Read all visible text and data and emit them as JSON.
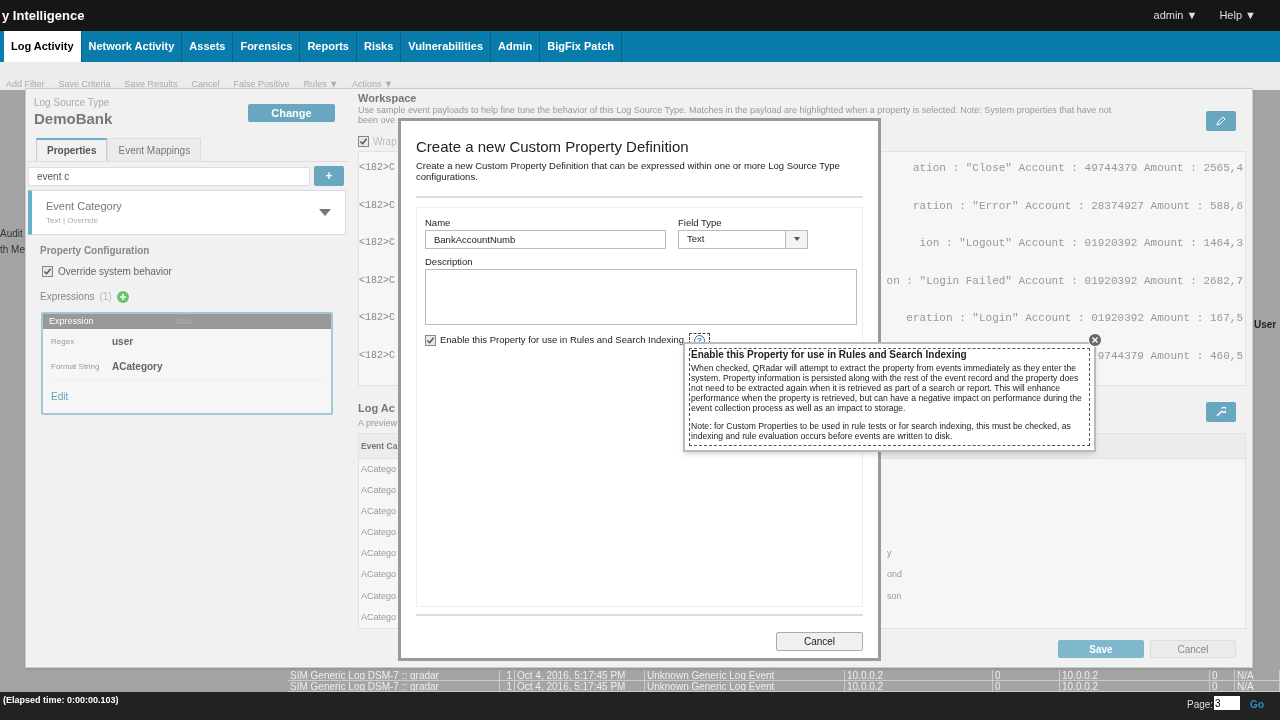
{
  "app_bar": {
    "title": "y Intelligence",
    "menus": [
      "admin ▼",
      "Help ▼"
    ]
  },
  "nav_tabs": [
    {
      "label": "Log Activity",
      "selected": true
    },
    {
      "label": "Network Activity",
      "selected": false
    },
    {
      "label": "Assets",
      "selected": false
    },
    {
      "label": "Forensics",
      "selected": false
    },
    {
      "label": "Reports",
      "selected": false
    },
    {
      "label": "Risks",
      "selected": false
    },
    {
      "label": "Vulnerabilities",
      "selected": false
    },
    {
      "label": "Admin",
      "selected": false
    },
    {
      "label": "BigFix Patch",
      "selected": false
    }
  ],
  "toolbar": [
    "Add Filter",
    "Save Criteria",
    "Save Results",
    "Cancel",
    "False Positive",
    "Rules ▼",
    "Actions ▼"
  ],
  "background_fragments": {
    "left": [
      "Audit",
      "th Me"
    ],
    "right": "User"
  },
  "editor": {
    "log_source_type_label": "Log Source Type",
    "log_source_type": "DemoBank",
    "change_button": "Change",
    "tabs": [
      {
        "label": "Properties",
        "selected": true
      },
      {
        "label": "Event Mappings",
        "selected": false
      }
    ],
    "search": {
      "value": "event c"
    },
    "add_button": "+",
    "property": {
      "name": "Event Category",
      "meta": "Text | Override"
    },
    "configuration": {
      "title": "Property Configuration",
      "override": {
        "label": "Override system behavior",
        "checked": true
      }
    },
    "expressions": {
      "label": "Expressions",
      "count": "(1)",
      "items": [
        {
          "title": "Expression",
          "fields": [
            {
              "label": "Regex",
              "value": "user"
            },
            {
              "label": "Format String",
              "value": "ACategory"
            }
          ],
          "edit": "Edit"
        }
      ]
    },
    "workspace": {
      "title": "Workspace",
      "description_lines": [
        "Use sample event payloads to help fine tune the behavior of this Log Source Type. Matches in the payload are highlighted when a property is selected. Note: System properties that have not",
        "been ove"
      ],
      "wrap": {
        "label": "Wrap",
        "checked": true
      },
      "payloads": [
        {
          "start": "<182>C",
          "end": "ation : \"Close\" Account : 49744379 Amount : 2565,4"
        },
        {
          "start": "<182>C",
          "end": "ration : \"Error\" Account : 28374927 Amount : 588,6"
        },
        {
          "start": "<182>C",
          "end": "ion : \"Logout\" Account : 01920392 Amount : 1464,3"
        },
        {
          "start": "<182>C",
          "end": "on : \"Login Failed\" Account : 01920392 Amount : 2682,7"
        },
        {
          "start": "<182>C",
          "end": "eration : \"Login\" Account : 01920392 Amount : 167,5"
        },
        {
          "start": "<182>C",
          "end": "9744379 Amount : 460,5"
        }
      ]
    },
    "preview": {
      "title": "Log Ac",
      "subtitle": "A preview",
      "column": "Event Ca",
      "rows": [
        {
          "cell": "ACatego"
        },
        {
          "cell": "ACatego"
        },
        {
          "cell": "ACatego"
        },
        {
          "cell": "ACatego"
        },
        {
          "cell": "ACatego",
          "end": "y"
        },
        {
          "cell": "ACatego",
          "end": "ond"
        },
        {
          "cell": "ACatego",
          "end": "son"
        },
        {
          "cell": "ACatego"
        }
      ]
    },
    "save_button": "Save",
    "cancel_button": "Cancel"
  },
  "dialog": {
    "title": "Create a new Custom Property Definition",
    "description": "Create a new Custom Property Definition that can be expressed within one or more Log Source Type configurations.",
    "name": {
      "label": "Name",
      "value": "BankAccountNumb"
    },
    "field_type": {
      "label": "Field Type",
      "value": "Text"
    },
    "description_field": {
      "label": "Description"
    },
    "enable": {
      "label": "Enable this Property for use in Rules and Search Indexing",
      "checked": true
    },
    "help": "?",
    "cancel": "Cancel"
  },
  "tooltip": {
    "title": "Enable this Property for use in Rules and Search Indexing",
    "paragraphs": [
      "When checked, QRadar will attempt to extract the property from events immediately as they enter the system. Property information is persisted along with the rest of the event record and the property does not need to be extracted again when it is retrieved as part of a search or report. This will enhance performance when the property is retrieved, but can have a negative impact on performance during the event collection process as well as an impact to storage.",
      "Note: for Custom Properties to be used in rule tests or for search indexing, this must be checked, as indexing and rule evaluation occurs before events are written to disk."
    ]
  },
  "background_rows": [
    [
      "SIM Generic Log DSM-7 :: qradar",
      "1",
      "Oct 4, 2016, 5:17:45 PM",
      "Unknown Generic Log Event",
      "10.0.0.2",
      "0",
      "10.0.0.2",
      "0",
      "N/A"
    ],
    [
      "SIM Generic Log DSM-7 :: qradar",
      "1",
      "Oct 4, 2016, 5:17:45 PM",
      "Unknown Generic Log Event",
      "10.0.0.2",
      "0",
      "10.0.0.2",
      "0",
      "N/A"
    ]
  ],
  "status_bar": {
    "elapsed": "(Elapsed time: 0:00:00.103)",
    "page_label": "Page:",
    "page_value": "3",
    "go": "Go"
  }
}
